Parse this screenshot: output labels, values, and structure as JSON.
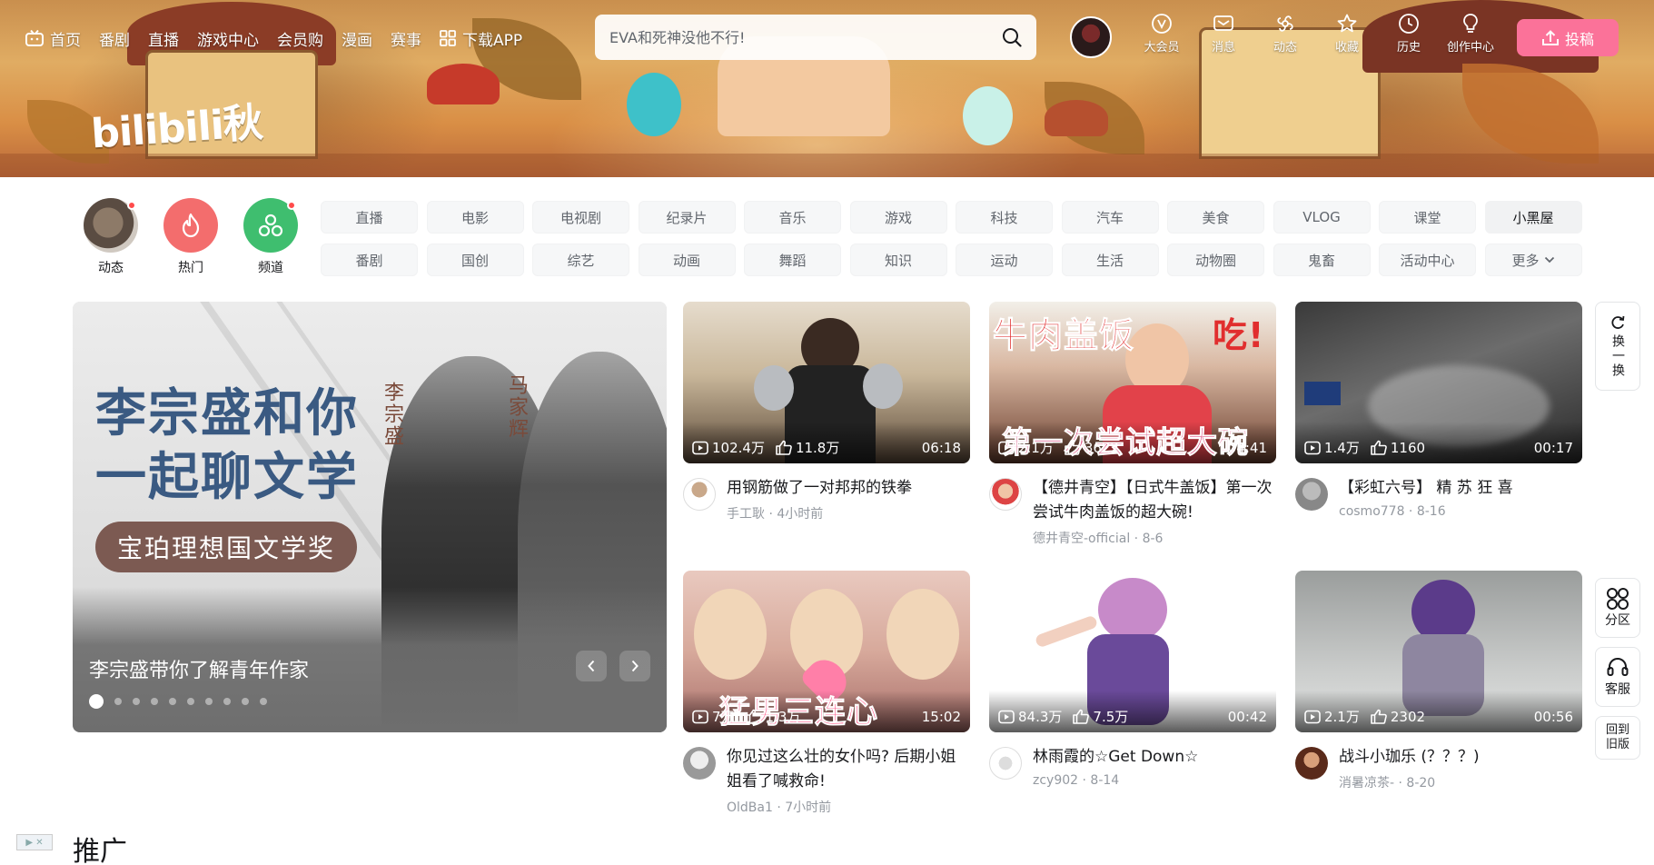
{
  "brand": {
    "logo_text": "bilibili秋"
  },
  "topnav": [
    {
      "label": "首页",
      "icon": "tv-icon"
    },
    {
      "label": "番剧"
    },
    {
      "label": "直播"
    },
    {
      "label": "游戏中心"
    },
    {
      "label": "会员购"
    },
    {
      "label": "漫画"
    },
    {
      "label": "赛事"
    },
    {
      "label": "下载APP",
      "icon": "grid-icon"
    }
  ],
  "search": {
    "placeholder": "EVA和死神没他不行!"
  },
  "user_icons": [
    {
      "label": "大会员",
      "icon": "vip-icon"
    },
    {
      "label": "消息",
      "icon": "message-icon"
    },
    {
      "label": "动态",
      "icon": "dynamic-icon"
    },
    {
      "label": "收藏",
      "icon": "star-icon"
    },
    {
      "label": "历史",
      "icon": "clock-icon"
    },
    {
      "label": "创作中心",
      "icon": "bulb-icon"
    }
  ],
  "upload_label": "投稿",
  "quick_links": [
    {
      "label": "动态",
      "has_dot": true
    },
    {
      "label": "热门",
      "has_dot": false
    },
    {
      "label": "频道",
      "has_dot": true
    }
  ],
  "channels": [
    "直播",
    "电影",
    "电视剧",
    "纪录片",
    "音乐",
    "游戏",
    "科技",
    "汽车",
    "美食",
    "VLOG",
    "课堂",
    "小黑屋",
    "番剧",
    "国创",
    "综艺",
    "动画",
    "舞蹈",
    "知识",
    "运动",
    "生活",
    "动物圈",
    "鬼畜",
    "活动中心",
    "更多"
  ],
  "carousel": {
    "headline_line1": "李宗盛和你",
    "headline_line2": "一起聊文学",
    "name_left": "李宗盛",
    "name_right": "马家辉",
    "pill": "宝珀理想国文学奖",
    "caption": "李宗盛带你了解青年作家",
    "dot_count": 10,
    "active_dot": 0
  },
  "videos": [
    {
      "title": "用钢筋做了一对邦邦的铁拳",
      "author": "手工耿",
      "date": "4小时前",
      "views": "102.4万",
      "likes": "11.8万",
      "duration": "06:18",
      "overlay": ""
    },
    {
      "title": "【德井青空】【日式牛盖饭】第一次尝试牛肉盖饭的超大碗!",
      "author": "德井青空-official",
      "date": "8-6",
      "views": "2.1万",
      "likes": "3622",
      "duration": "04:41",
      "overlay_top": "牛肉盖饭",
      "overlay_top_right": "吃!",
      "overlay_bottom": "第一次尝试超大碗"
    },
    {
      "title": "【彩虹六号】 精 苏 狂 喜",
      "author": "cosmo778",
      "date": "8-16",
      "views": "1.4万",
      "likes": "1160",
      "duration": "00:17",
      "overlay": ""
    },
    {
      "title": "你见过这么壮的女仆吗? 后期小姐姐看了喊救命!",
      "author": "OldBa1",
      "date": "7小时前",
      "views": "7万",
      "likes": "1.3万",
      "duration": "15:02",
      "overlay_bottom": "猛男三连心"
    },
    {
      "title": "林雨霞的☆Get Down☆",
      "author": "zcy902",
      "date": "8-14",
      "views": "84.3万",
      "likes": "7.5万",
      "duration": "00:42",
      "overlay": ""
    },
    {
      "title": "战斗小珈乐 (？？？)",
      "author": "消暑凉茶-",
      "date": "8-20",
      "views": "2.1万",
      "likes": "2302",
      "duration": "00:56",
      "overlay": ""
    }
  ],
  "float_buttons": [
    {
      "label": "换一换",
      "icon": "refresh-icon"
    },
    {
      "label": "分区",
      "icon": "grid-icon"
    },
    {
      "label": "客服",
      "icon": "headset-icon"
    },
    {
      "label": "回到旧版"
    }
  ],
  "promo_title": "推广",
  "colors": {
    "accent_pink": "#fb7299",
    "hot_red": "#f36d6d",
    "channel_green": "#3fbe6f"
  }
}
